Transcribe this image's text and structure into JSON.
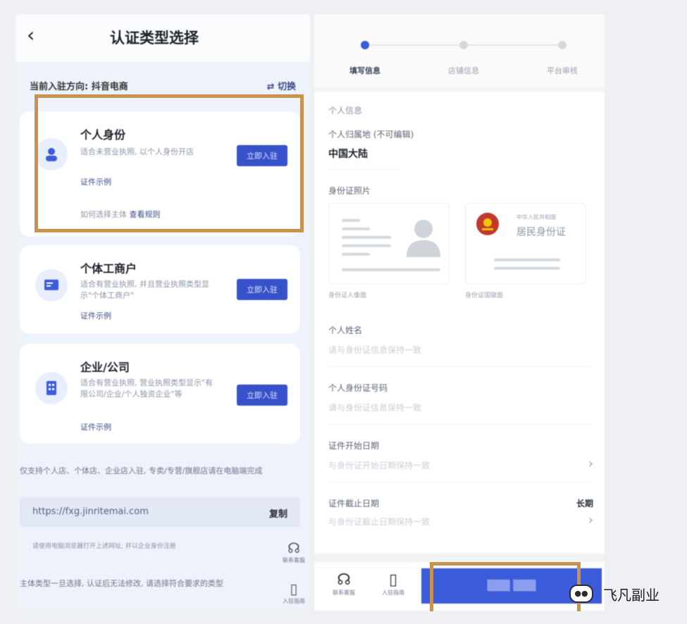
{
  "left": {
    "title": "认证类型选择",
    "back_glyph": "‹",
    "direction_label": "当前入驻方向: 抖音电商",
    "switch_label": "⇄ 切换",
    "cards": [
      {
        "title": "个人身份",
        "desc": "适合未营业执照, 以个人身份开店",
        "link": "证件示例",
        "button": "立即入驻",
        "footer_prefix": "如何选择主体",
        "footer_link": "查看规则"
      },
      {
        "title": "个体工商户",
        "desc": "适合有营业执照, 并且营业执照类型显示\"个体工商户\"",
        "link": "证件示例",
        "button": "立即入驻"
      },
      {
        "title": "企业/公司",
        "desc": "适合有营业执照, 营业执照类型显示\"有限公司/企业/个人独资企业\"等",
        "link": "证件示例",
        "button": "立即入驻"
      }
    ],
    "hint": "仅支持个人店、个体店、企业店入驻, 专卖/专营/旗舰店请在电脑端完成",
    "url": "https://fxg.jinritemai.com",
    "copy_label": "复制",
    "url_note": "请使用电脑浏览器打开上述网址, 并以企业身份注册",
    "bottom_note": "主体类型一旦选择, 认证后无法修改, 请选择符合要求的类型",
    "side_icons": [
      {
        "icon": "headset-icon",
        "glyph": "☊",
        "label": "联系客服"
      },
      {
        "icon": "document-icon",
        "glyph": "▯",
        "label": "入驻指南"
      }
    ]
  },
  "right": {
    "steps": [
      "填写信息",
      "店铺信息",
      "平台审核"
    ],
    "section_title": "个人信息",
    "region_label": "个人归属地 (不可编辑)",
    "region_value": "中国大陆",
    "id_photo_label": "身份证照片",
    "id_front_caption": "身份证人像面",
    "id_back_caption": "身份证国徽面",
    "id_back_title": "居民身份证",
    "id_back_subtitle": "中华人民共和国",
    "fields": [
      {
        "label": "个人姓名",
        "placeholder": "请与身份证信息保持一致"
      },
      {
        "label": "个人身份证号码",
        "placeholder": "请与身份证信息保持一致"
      },
      {
        "label": "证件开始日期",
        "placeholder": "与身份证开始日期保持一致"
      },
      {
        "label": "证件截止日期",
        "placeholder": "与身份证截止日期保持一致"
      }
    ],
    "longterm_label": "长期",
    "bottom_icons": [
      {
        "icon": "headset-icon",
        "glyph": "☊",
        "label": "联系客服"
      },
      {
        "icon": "document-icon",
        "glyph": "▯",
        "label": "入驻指南"
      }
    ],
    "submit_label": "▒▒▒ ▒▒▒"
  },
  "watermark": {
    "icon_glyph": "●●",
    "text": "飞凡副业"
  },
  "colors": {
    "accent": "#3b5bdb",
    "highlight_box": "#c8934f"
  }
}
